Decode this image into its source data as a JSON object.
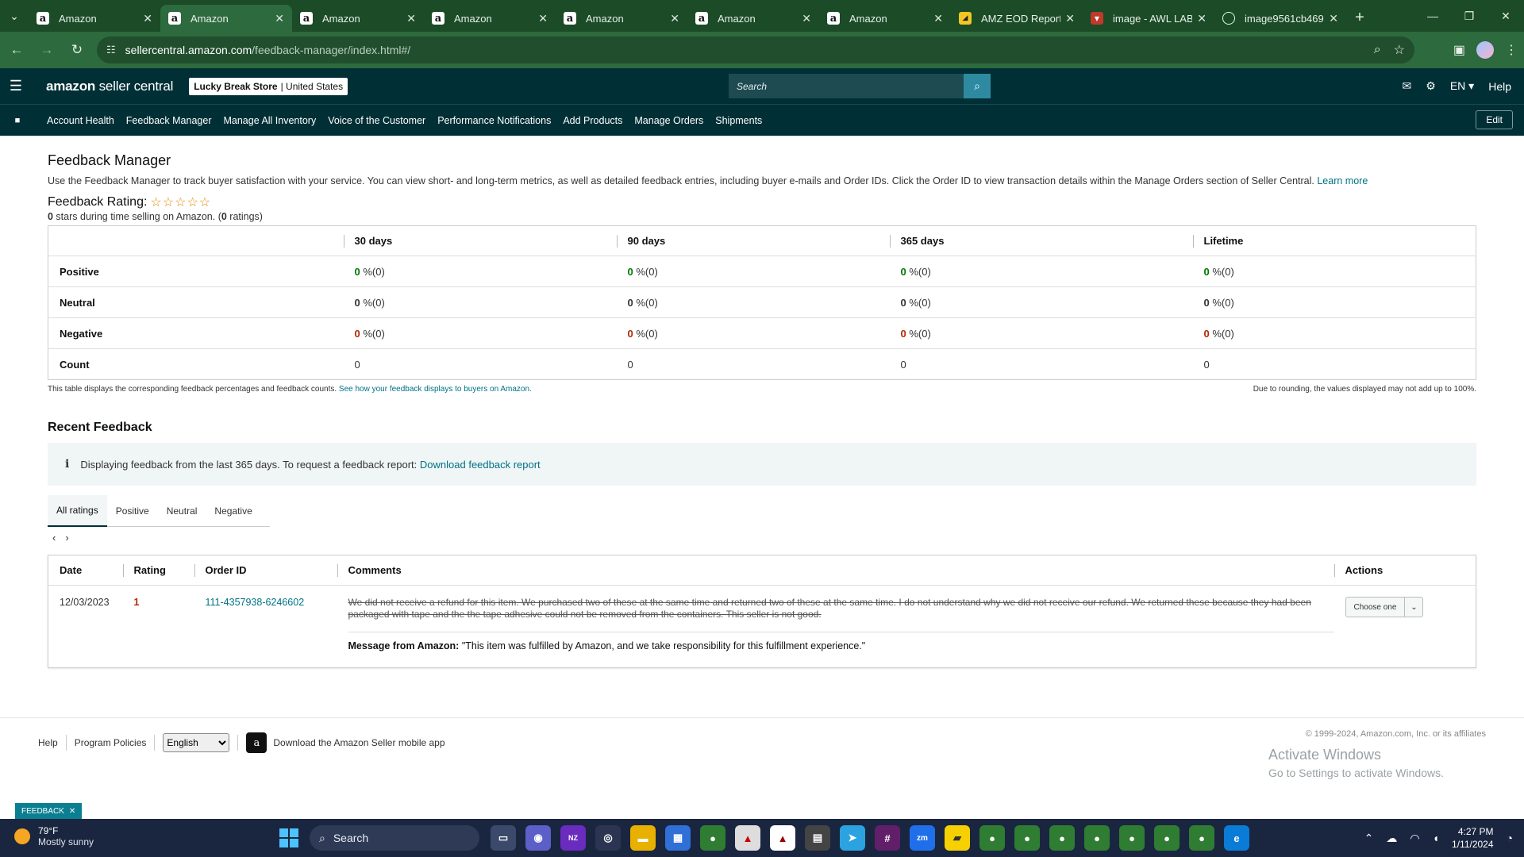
{
  "browser": {
    "tabs": [
      {
        "title": "Amazon",
        "icon": "amazon-icon",
        "active": false
      },
      {
        "title": "Amazon",
        "icon": "amazon-icon",
        "active": true
      },
      {
        "title": "Amazon",
        "icon": "amazon-icon",
        "active": false
      },
      {
        "title": "Amazon",
        "icon": "amazon-icon",
        "active": false
      },
      {
        "title": "Amazon",
        "icon": "amazon-icon",
        "active": false
      },
      {
        "title": "Amazon",
        "icon": "amazon-icon",
        "active": false
      },
      {
        "title": "Amazon",
        "icon": "amazon-icon",
        "active": false
      },
      {
        "title": "AMZ EOD Report",
        "icon": "report-icon",
        "active": false
      },
      {
        "title": "image - AWL LABEL",
        "icon": "awl-icon",
        "active": false
      },
      {
        "title": "image9561cb469",
        "icon": "globe-icon",
        "active": false
      }
    ],
    "url_host": "sellercentral.amazon.com",
    "url_path": "/feedback-manager/index.html#/"
  },
  "header": {
    "logo_main": "amazon",
    "logo_sub": " seller central",
    "store_name": "Lucky Break Store",
    "store_region": "| United States",
    "search_placeholder": "Search",
    "language": "EN",
    "help": "Help"
  },
  "nav": {
    "links": [
      "Account Health",
      "Feedback Manager",
      "Manage All Inventory",
      "Voice of the Customer",
      "Performance Notifications",
      "Add Products",
      "Manage Orders",
      "Shipments"
    ],
    "edit": "Edit"
  },
  "page": {
    "title": "Feedback Manager",
    "description": "Use the Feedback Manager to track buyer satisfaction with your service. You can view short- and long-term metrics, as well as detailed feedback entries, including buyer e-mails and Order IDs. Click the Order ID to view transaction details within the Manage Orders section of Seller Central.",
    "learn_more": "Learn more",
    "rating_label": "Feedback Rating:",
    "stars": "☆☆☆☆☆",
    "rating_stars_value": "0",
    "rating_mid": " stars during time selling on Amazon. (",
    "rating_count": "0",
    "rating_end": " ratings)"
  },
  "metrics": {
    "columns": [
      "30 days",
      "90 days",
      "365 days",
      "Lifetime"
    ],
    "rows": [
      {
        "label": "Positive",
        "values": [
          "0",
          "0",
          "0",
          "0"
        ],
        "suffix": " %(0)"
      },
      {
        "label": "Neutral",
        "values": [
          "0",
          "0",
          "0",
          "0"
        ],
        "suffix": " %(0)"
      },
      {
        "label": "Negative",
        "values": [
          "0",
          "0",
          "0",
          "0"
        ],
        "suffix": " %(0)"
      },
      {
        "label": "Count",
        "values": [
          "0",
          "0",
          "0",
          "0"
        ],
        "suffix": ""
      }
    ],
    "note_left": "This table displays the corresponding feedback percentages and feedback counts.",
    "note_link": "See how your feedback displays to buyers on Amazon.",
    "note_right": "Due to rounding, the values displayed may not add up to 100%."
  },
  "recent": {
    "heading": "Recent Feedback",
    "info_text": "Displaying feedback from the last 365 days. To request a feedback report:",
    "info_link": "Download feedback report",
    "tabs": [
      "All ratings",
      "Positive",
      "Neutral",
      "Negative"
    ],
    "columns": {
      "date": "Date",
      "rating": "Rating",
      "order": "Order ID",
      "comments": "Comments",
      "actions": "Actions"
    },
    "entry": {
      "date": "12/03/2023",
      "rating": "1",
      "order_id": "111-4357938-6246602",
      "comment": "We did not receive a refund for this item. We purchased two of these at the same time and returned two of these at the same time. I do not understand why we did not receive our refund. We returned these because they had been packaged with tape and the the tape adhesive could not be removed from the containers. This seller is not good.",
      "msg_label": "Message from Amazon:",
      "msg_text": " \"This item was fulfilled by Amazon, and we take responsibility for this fulfillment experience.\"",
      "action_select": "Choose one"
    }
  },
  "footer": {
    "help": "Help",
    "policies": "Program Policies",
    "language_selected": "English",
    "app_text": "Download the Amazon Seller mobile app",
    "copyright": "© 1999-2024, Amazon.com, Inc. or its affiliates",
    "activate_title": "Activate Windows",
    "activate_sub": "Go to Settings to activate Windows.",
    "feedback_pill": "FEEDBACK"
  },
  "taskbar": {
    "temp": "79°F",
    "weather": "Mostly sunny",
    "search": "Search",
    "time": "4:27 PM",
    "date": "1/11/2024"
  },
  "colors": {
    "brand_dark": "#002f36",
    "positive": "#007600",
    "negative": "#b12704",
    "link": "#007185",
    "chrome": "#2d6a3d"
  }
}
